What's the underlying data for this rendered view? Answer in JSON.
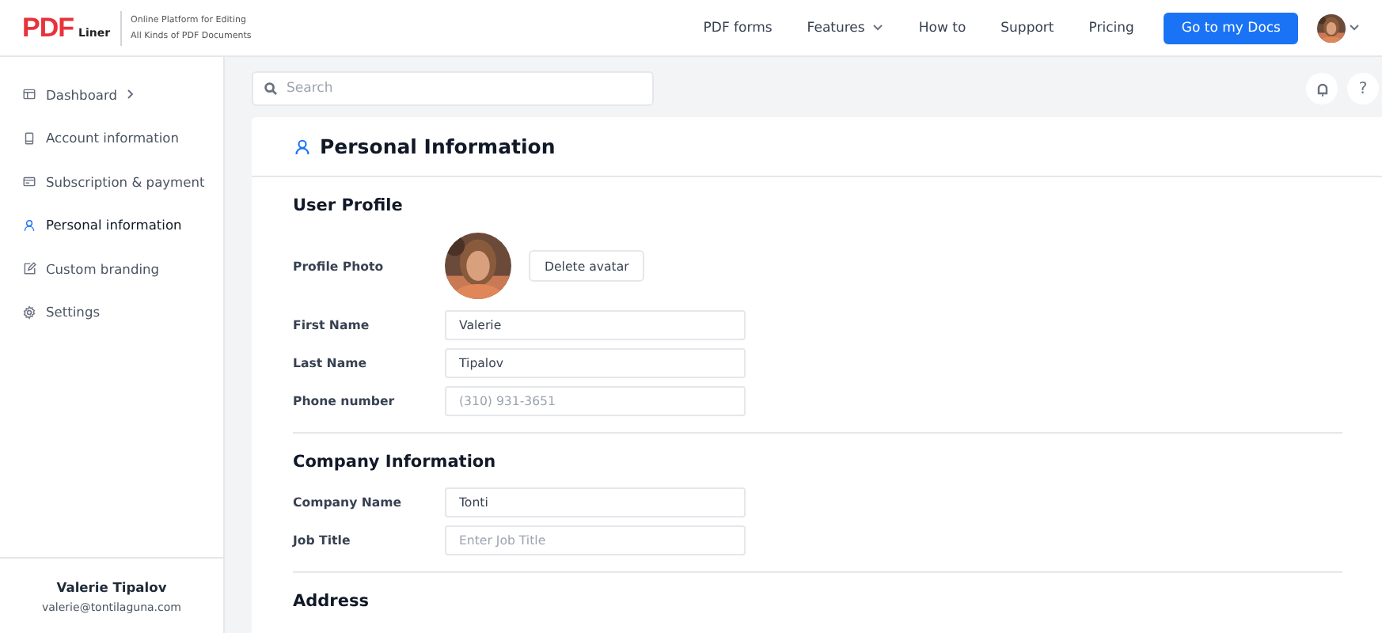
{
  "header": {
    "logo": {
      "mark": "PDF",
      "word": "Liner"
    },
    "tagline": [
      "Online Platform for Editing",
      "All Kinds of PDF Documents"
    ],
    "nav": [
      {
        "label": "PDF forms",
        "dropdown": false
      },
      {
        "label": "Features",
        "dropdown": true
      },
      {
        "label": "How to",
        "dropdown": false
      },
      {
        "label": "Support",
        "dropdown": false
      },
      {
        "label": "Pricing",
        "dropdown": false
      }
    ],
    "cta": "Go to my Docs"
  },
  "sidebar": {
    "items": [
      {
        "label": "Dashboard",
        "chevron": true,
        "selected": false
      },
      {
        "label": "Account information",
        "chevron": false,
        "selected": false
      },
      {
        "label": "Subscription & payment",
        "chevron": false,
        "selected": false
      },
      {
        "label": "Personal information",
        "chevron": false,
        "selected": true
      },
      {
        "label": "Custom branding",
        "chevron": false,
        "selected": false
      },
      {
        "label": "Settings",
        "chevron": false,
        "selected": false
      }
    ],
    "user": {
      "name": "Valerie Tipalov",
      "email": "valerie@tontilaguna.com"
    }
  },
  "search": {
    "placeholder": "Search"
  },
  "help": "?",
  "page_title": "Personal Information",
  "sections": [
    {
      "title": "User Profile",
      "rows": [
        {
          "label": "Profile Photo",
          "button": "Delete avatar"
        },
        {
          "kind": "field",
          "label": "First Name",
          "value": "Valerie"
        },
        {
          "kind": "field",
          "label": "Last Name",
          "value": "Tipalov"
        },
        {
          "kind": "field",
          "label": "Phone number",
          "placeholder": "(310) 931-3651"
        }
      ]
    },
    {
      "title": "Company Information",
      "rows": [
        {
          "kind": "field",
          "label": "Company Name",
          "value": "Tonti"
        },
        {
          "kind": "field",
          "label": "Job Title",
          "placeholder": "Enter Job Title"
        }
      ]
    },
    {
      "title": "Address"
    }
  ]
}
